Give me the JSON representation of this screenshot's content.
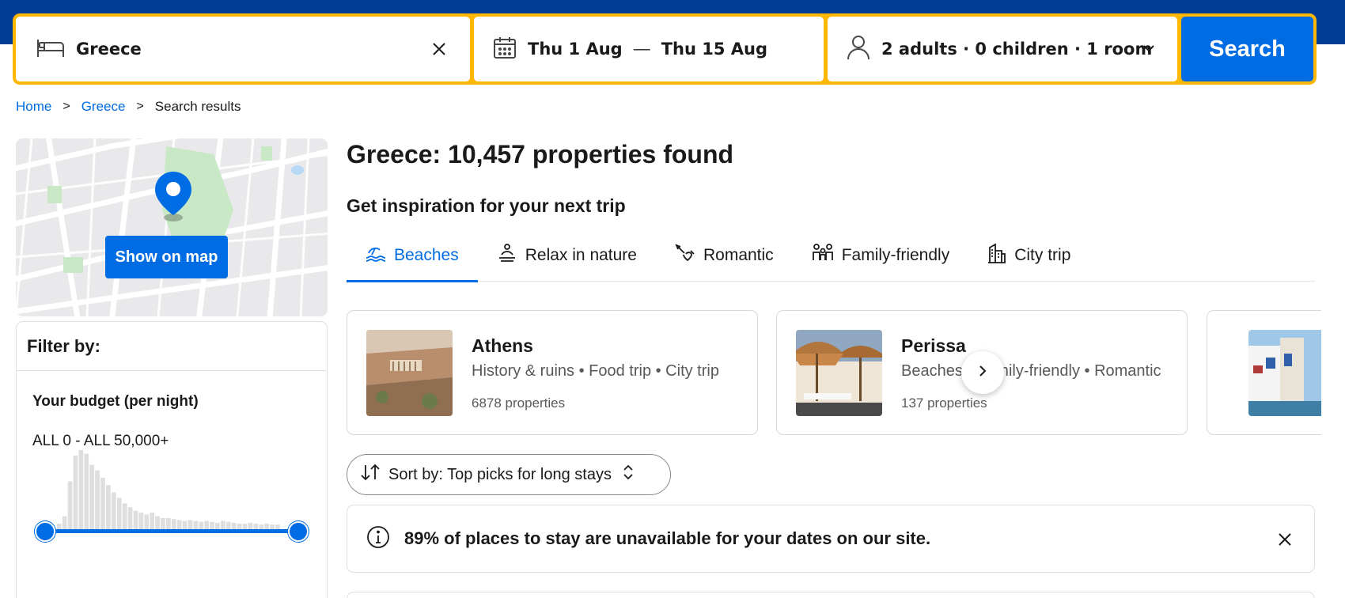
{
  "search": {
    "destination": "Greece",
    "check_in": "Thu 1 Aug",
    "date_separator": "—",
    "check_out": "Thu 15 Aug",
    "guests": "2 adults · 0 children · 1 room",
    "search_label": "Search",
    "icons": {
      "bed": "bed-icon",
      "calendar": "calendar-icon",
      "person": "person-icon",
      "clear": "close-icon",
      "dropdown": "chevron-down-icon"
    }
  },
  "breadcrumb": {
    "items": [
      "Home",
      "Greece"
    ],
    "current": "Search results",
    "separator": ">"
  },
  "map": {
    "button_label": "Show on map"
  },
  "filter": {
    "heading": "Filter by:",
    "budget_title": "Your budget (per night)",
    "budget_range": "ALL 0 - ALL 50,000+",
    "slider_min_fraction": 0,
    "slider_max_fraction": 1,
    "histogram": [
      2,
      6,
      14,
      52,
      80,
      86,
      82,
      70,
      64,
      56,
      48,
      40,
      34,
      28,
      24,
      20,
      18,
      16,
      18,
      14,
      12,
      12,
      11,
      10,
      9,
      10,
      9,
      8,
      9,
      8,
      7,
      9,
      8,
      7,
      6,
      6,
      7,
      6,
      5,
      6,
      5,
      5
    ]
  },
  "results": {
    "title": "Greece: 10,457 properties found",
    "inspiration_heading": "Get inspiration for your next trip",
    "tabs": [
      {
        "label": "Beaches",
        "icon": "beach-icon",
        "active": true
      },
      {
        "label": "Relax in nature",
        "icon": "nature-icon",
        "active": false
      },
      {
        "label": "Romantic",
        "icon": "romantic-icon",
        "active": false
      },
      {
        "label": "Family-friendly",
        "icon": "family-icon",
        "active": false
      },
      {
        "label": "City trip",
        "icon": "city-icon",
        "active": false
      }
    ],
    "cards": [
      {
        "name": "Athens",
        "tags": "History & ruins • Food trip • City trip",
        "count": "6878 properties"
      },
      {
        "name": "Perissa",
        "tags": "Beaches • Family-friendly • Romantic",
        "count": "137 properties"
      }
    ],
    "sort_label": "Sort by: Top picks for long stays",
    "alert_text": "89% of places to stay are unavailable for your dates on our site."
  },
  "colors": {
    "brand_dark": "#003b95",
    "accent": "#006ce4",
    "search_border": "#ffb700"
  }
}
